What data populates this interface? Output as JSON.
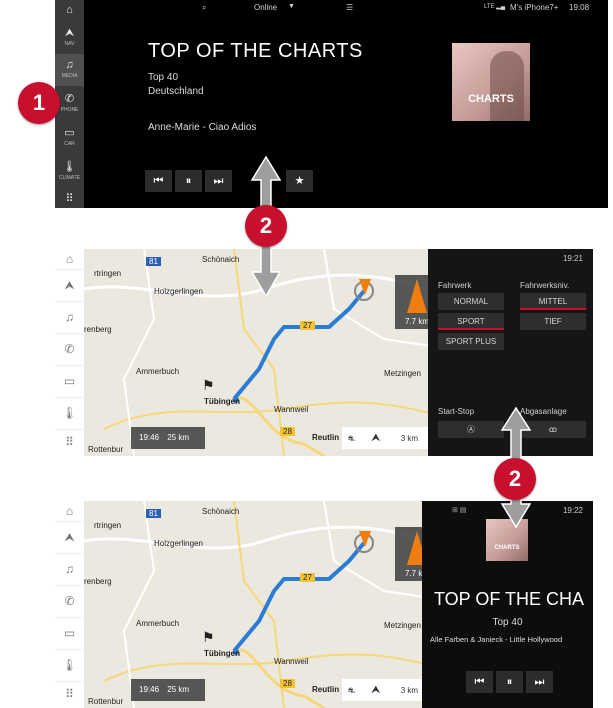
{
  "colors": {
    "accent_red": "#c8102e",
    "route_blue": "#2b7cd3",
    "arrow_orange": "#f07d10"
  },
  "panel1": {
    "status": {
      "search_icon": "search-icon",
      "source": "Online",
      "caret": "▼",
      "list_icon": "list-icon",
      "phone_text": "M's iPhone7+",
      "time": "19:08"
    },
    "sidebar": [
      {
        "icon": "nav-icon",
        "glyph": "⮝",
        "label": "NAV"
      },
      {
        "icon": "music-note-icon",
        "glyph": "♫",
        "label": "MEDIA"
      },
      {
        "icon": "phone-icon",
        "glyph": "✆",
        "label": "PHONE"
      },
      {
        "icon": "car-icon",
        "glyph": "▭",
        "label": "CAR"
      },
      {
        "icon": "thermometer-icon",
        "glyph": "🌡",
        "label": "CLIMATE"
      },
      {
        "icon": "apps-grid-icon",
        "glyph": "⠿",
        "label": ""
      }
    ],
    "title": "TOP OF THE CHARTS",
    "station": "Top 40",
    "country": "Deutschland",
    "track": "Anne-Marie - Ciao Adios",
    "cover_text": "CHARTS",
    "controls": {
      "prev": "⏮",
      "pause": "⏸",
      "next": "⏭",
      "fav": "★"
    }
  },
  "badges": {
    "one": "1",
    "two": "2"
  },
  "panel2": {
    "map": {
      "road_81": "81",
      "town_schoenaich": "Schönaich",
      "town_holzgerlingen": "Holzgerlingen",
      "town_aidlingen": "rtringen",
      "town_ammerbuch": "Ammerbuch",
      "town_tuebingen": "Tübingen",
      "town_wannweil": "Wannweil",
      "town_metzingen": "Metzingen",
      "town_reutlingen": "Reutlin",
      "town_rottenburg": "Rottenbur",
      "town_herrenberg": "renberg",
      "town_nurtingen": "N",
      "road_27": "27",
      "road_28": "28",
      "eta_time": "19:46",
      "eta_dist": "25 km",
      "next_dist": "7.7 km",
      "scale": "3 km"
    },
    "right": {
      "time": "19:21",
      "fahrwerk_label": "Fahrwerk",
      "fahrwerksniv_label": "Fahrwerksniv.",
      "normal": "NORMAL",
      "sport": "SPORT",
      "sport_plus": "SPORT PLUS",
      "mittel": "MITTEL",
      "tief": "TIEF",
      "start_stop_label": "Start-Stop",
      "abgasanlage_label": "Abgasanlage",
      "start_stop_glyph": "Ⓐ",
      "exhaust_glyph": "ꝏ"
    }
  },
  "panel3": {
    "right": {
      "time": "19:22",
      "cover_text": "CHARTS",
      "title": "TOP OF THE CHA",
      "station": "Top 40",
      "track": "Alle Farben & Janieck - Little Hollywood",
      "prev": "⏮",
      "pause": "⏸",
      "next": "⏭"
    }
  }
}
